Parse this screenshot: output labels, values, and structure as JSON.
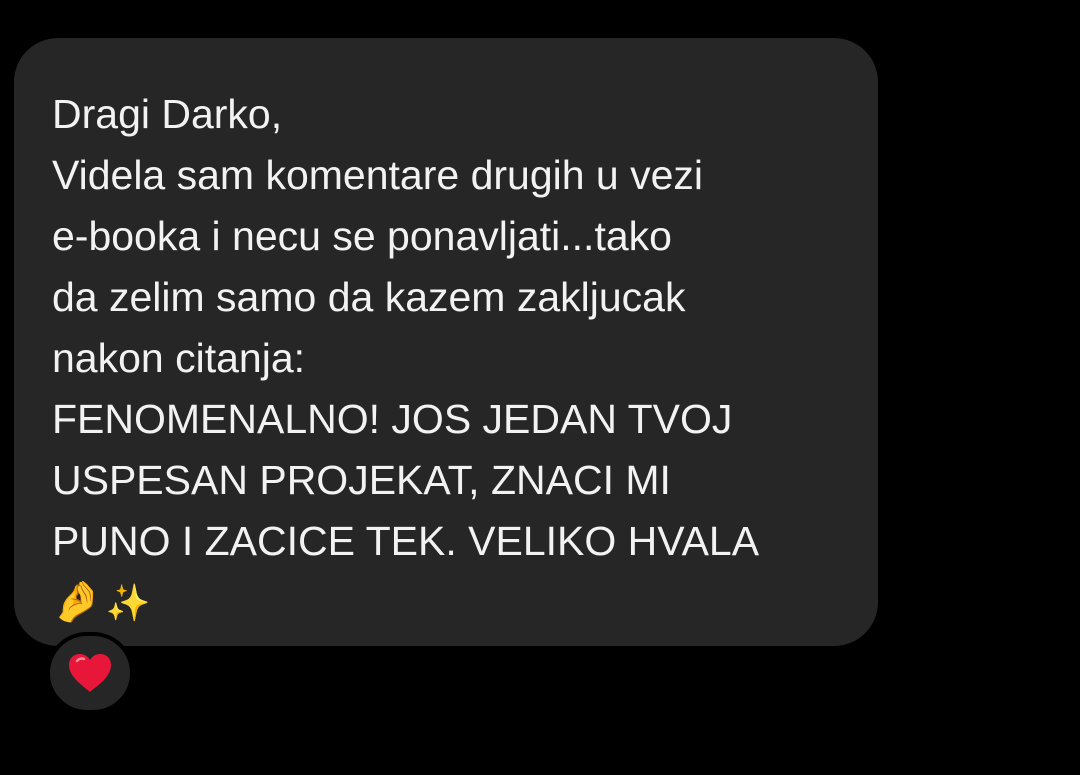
{
  "message": {
    "lines": [
      "Dragi Darko,",
      "Videla sam komentare drugih u vezi",
      "e-booka i necu se ponavljati...tako",
      "da zelim samo da kazem zakljucak",
      "nakon citanja:",
      "FENOMENALNO! JOS JEDAN TVOJ",
      "USPESAN PROJEKAT, ZNACI MI",
      "PUNO I ZACICE TEK. VELIKO HVALA"
    ],
    "emojis": {
      "hand": "🤌",
      "sparkles": "✨"
    }
  },
  "reaction": {
    "icon": "red-heart-icon",
    "color": "#e8173a"
  },
  "colors": {
    "background": "#000000",
    "bubble": "#262626",
    "text": "#f2f2f2"
  }
}
